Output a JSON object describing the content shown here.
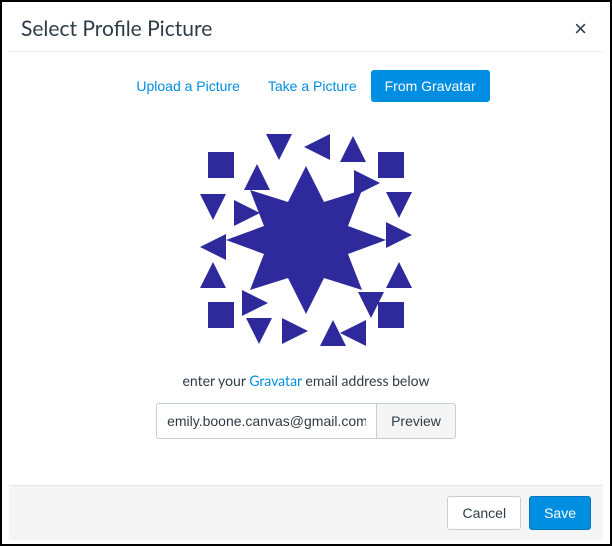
{
  "modal": {
    "title": "Select Profile Picture",
    "close_glyph": "×"
  },
  "tabs": {
    "upload": "Upload a Picture",
    "take": "Take a Picture",
    "gravatar": "From Gravatar"
  },
  "hint": {
    "prefix": "enter your ",
    "link": "Gravatar",
    "suffix": " email address below"
  },
  "form": {
    "email_value": "emily.boone.canvas@gmail.com",
    "preview_label": "Preview"
  },
  "footer": {
    "cancel": "Cancel",
    "save": "Save"
  },
  "colors": {
    "accent": "#008ee2",
    "identicon": "#2e2a9b"
  }
}
